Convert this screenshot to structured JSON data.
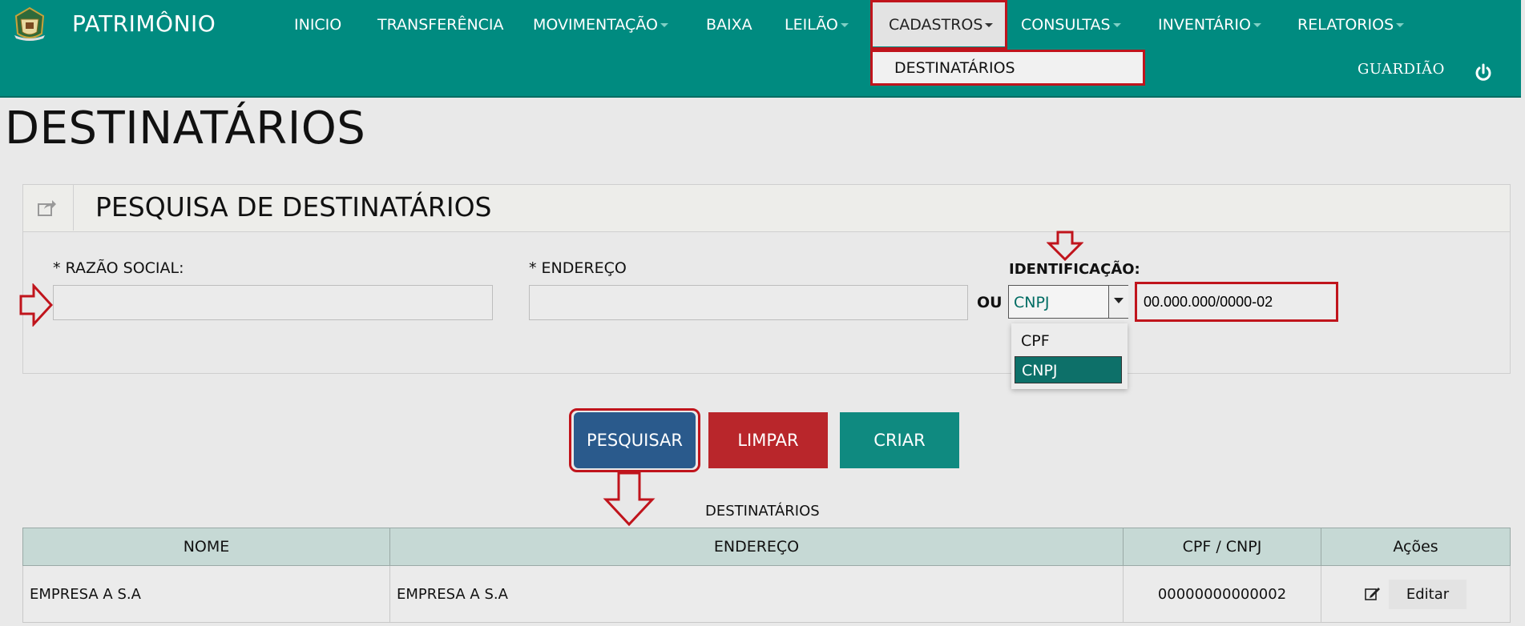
{
  "brand": {
    "title": "PATRIMÔNIO"
  },
  "nav": {
    "items": [
      {
        "label": "INICIO"
      },
      {
        "label": "TRANSFERÊNCIA"
      },
      {
        "label": "MOVIMENTAÇÃO"
      },
      {
        "label": "BAIXA"
      },
      {
        "label": "LEILÃO"
      },
      {
        "label": "CADASTROS"
      },
      {
        "label": "CONSULTAS"
      },
      {
        "label": "INVENTÁRIO"
      },
      {
        "label": "RELATORIOS"
      }
    ],
    "submenu_item": "DESTINATÁRIOS",
    "user": "GUARDIÃO"
  },
  "page": {
    "title": "DESTINATÁRIOS"
  },
  "search_panel": {
    "title": "PESQUISA DE DESTINATÁRIOS",
    "razao_label": "* RAZÃO SOCIAL:",
    "razao_value": "",
    "endereco_label": "* ENDEREÇO",
    "endereco_value": "",
    "ou_label": "OU",
    "id_label": "IDENTIFICAÇÃO:",
    "id_type_selected": "CNPJ",
    "id_type_options": [
      "CPF",
      "CNPJ"
    ],
    "id_value": "00.000.000/0000-02"
  },
  "actions": {
    "search_label": "PESQUISAR",
    "clear_label": "LIMPAR",
    "create_label": "CRIAR"
  },
  "results": {
    "caption": "DESTINATÁRIOS",
    "columns": [
      "NOME",
      "ENDEREÇO",
      "CPF / CNPJ",
      "Ações"
    ],
    "rows": [
      {
        "nome": "EMPRESA A S.A",
        "endereco": "EMPRESA A S.A",
        "doc": "00000000000002",
        "action": "Editar"
      }
    ]
  },
  "colors": {
    "navbar": "#008b80",
    "highlight": "#c0141c",
    "search_button": "#2a5a8c",
    "clear_button": "#b9262b",
    "create_button": "#0f8a80"
  },
  "icons": [
    "logo-emblem",
    "caret-down-icon",
    "power-icon",
    "share-icon",
    "down-arrow-icon",
    "right-arrow-icon",
    "edit-icon"
  ]
}
